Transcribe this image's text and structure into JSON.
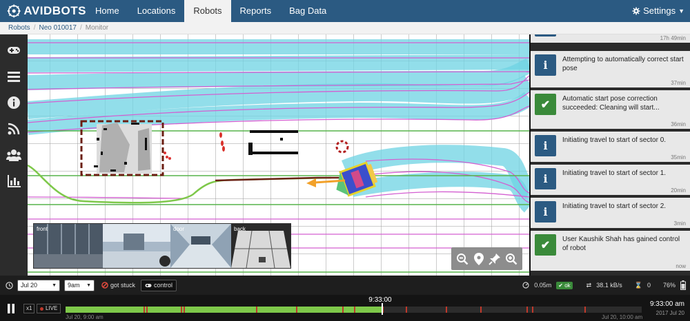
{
  "app": {
    "brand": "AVIDBOTS"
  },
  "nav": {
    "items": [
      "Home",
      "Locations",
      "Robots",
      "Reports",
      "Bag Data"
    ],
    "active": "Robots",
    "settings_label": "Settings"
  },
  "breadcrumb": {
    "items": [
      "Robots",
      "Neo 010017",
      "Monitor"
    ]
  },
  "sidebar": {
    "icons": [
      "gamepad-icon",
      "list-icon",
      "info-icon",
      "rss-icon",
      "users-icon",
      "bar-chart-icon"
    ]
  },
  "cameras": [
    {
      "label": "front"
    },
    {
      "label": ""
    },
    {
      "label": "door"
    },
    {
      "label": "back"
    }
  ],
  "events": [
    {
      "type": "info",
      "message": "",
      "time": "17h 49min"
    },
    {
      "type": "info",
      "message": "Attempting to automatically correct start pose",
      "time": "37min"
    },
    {
      "type": "ok",
      "message": "Automatic start pose correction succeeded: Cleaning will start...",
      "time": "36min"
    },
    {
      "type": "info",
      "message": "Initiating travel to start of sector 0.",
      "time": "35min"
    },
    {
      "type": "info",
      "message": "Initiating travel to start of sector 1.",
      "time": "20min"
    },
    {
      "type": "info",
      "message": "Initiating travel to start of sector 2.",
      "time": "3min"
    },
    {
      "type": "ok",
      "message": "User Kaushik Shah has gained control of robot",
      "time": "now"
    }
  ],
  "controls": {
    "date_value": "Jul 20",
    "hour_value": "9am",
    "stuck_label": "got stuck",
    "control_label": "control",
    "distance": "0.05m",
    "status_ok": "ok",
    "bandwidth": "38.1 kB/s",
    "bag_count": "0",
    "battery": "76%"
  },
  "timeline": {
    "speed": "x1",
    "live_label": "LIVE",
    "cursor_time": "9:33:00",
    "start_label": "Jul 20, 9:00 am",
    "end_label": "Jul 20, 10:00 am",
    "current_time": "9:33:00 am",
    "current_date": "2017 Jul 20",
    "progress": 0.55,
    "markers": [
      0.135,
      0.14,
      0.2,
      0.205,
      0.33,
      0.4,
      0.48,
      0.5,
      0.55,
      0.59,
      0.66,
      0.72,
      0.8,
      0.81,
      0.9
    ]
  },
  "colors": {
    "nav": "#2b5a82",
    "info": "#2b5a82",
    "ok": "#3a8a3a",
    "path": "#7ec84a",
    "trail": "#6dd3e3",
    "lane": "#d35fd1"
  }
}
